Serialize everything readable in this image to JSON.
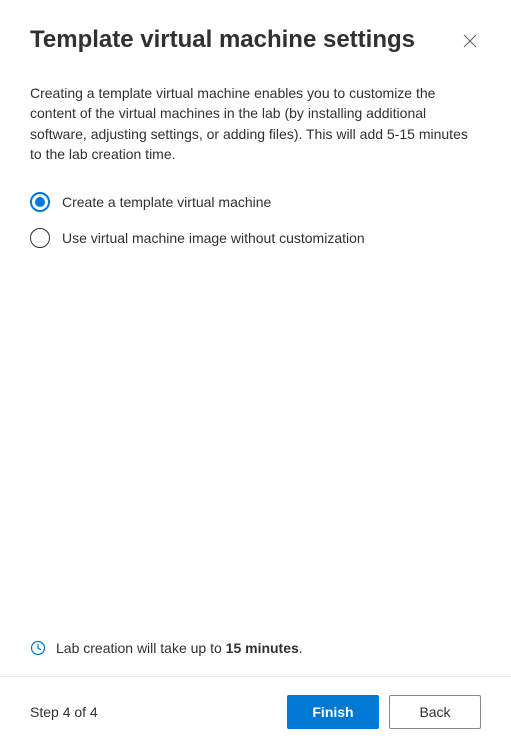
{
  "header": {
    "title": "Template virtual machine settings"
  },
  "description": "Creating a template virtual machine enables you to customize the content of the virtual machines in the lab (by installing additional software, adjusting settings, or adding files). This will add 5-15 minutes to the lab creation time.",
  "options": {
    "create": "Create a template virtual machine",
    "noCustom": "Use virtual machine image without customization",
    "selected": "create"
  },
  "info": {
    "prefix": "Lab creation will take up to ",
    "duration": "15 minutes",
    "suffix": "."
  },
  "footer": {
    "step": "Step 4 of 4",
    "finish": "Finish",
    "back": "Back"
  },
  "colors": {
    "primary": "#0078d4"
  }
}
